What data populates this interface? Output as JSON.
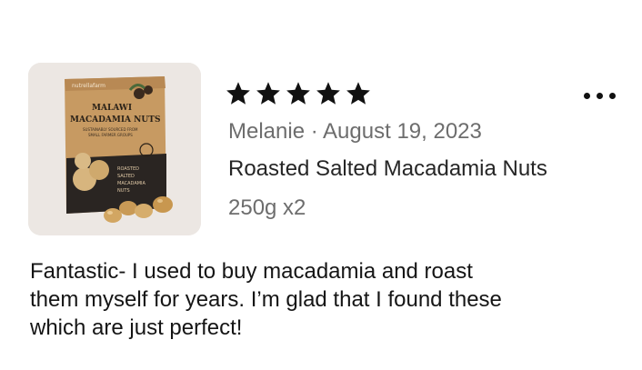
{
  "product_image": {
    "alt_icon": "macadamia-package-image",
    "package_text": {
      "brand": "nutrellafarm",
      "line1": "MALAWI",
      "line2": "MACADAMIA NUTS",
      "line3": "SUSTAINABLY SOURCED FROM",
      "line4": "SMALL FARMER GROUPS",
      "lower1": "ROASTED",
      "lower2": "SALTED",
      "lower3": "MACADAMIA",
      "lower4": "NUTS"
    }
  },
  "review": {
    "rating": 5,
    "rating_max": 5,
    "reviewer": "Melanie",
    "separator": "·",
    "date": "August 19, 2023",
    "reviewer_line": "Melanie · August 19, 2023",
    "product_name": "Roasted Salted Macadamia Nuts",
    "variant": "250g x2",
    "body_lines": [
      "Fantastic- I used to buy macadamia and roast",
      "them myself for years. I’m glad that I found these",
      "which are just perfect!"
    ]
  },
  "menu": {
    "icon": "more-horizontal-icon"
  },
  "colors": {
    "star": "#111111",
    "meta_text": "#6d6d6d",
    "body_text": "#151515"
  }
}
